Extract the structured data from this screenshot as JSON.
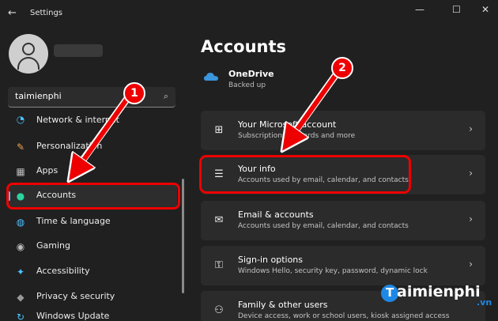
{
  "window": {
    "title": "Settings",
    "back_glyph": "←",
    "minimize_glyph": "—",
    "maximize_glyph": "☐",
    "close_glyph": "✕"
  },
  "sidebar": {
    "search_value": "taimienphi",
    "items": [
      {
        "label": "Network & internet",
        "icon": "wifi-icon"
      },
      {
        "label": "Personalization",
        "icon": "brush-icon"
      },
      {
        "label": "Apps",
        "icon": "apps-icon"
      },
      {
        "label": "Accounts",
        "icon": "person-icon",
        "active": true
      },
      {
        "label": "Time & language",
        "icon": "globe-clock-icon"
      },
      {
        "label": "Gaming",
        "icon": "gamepad-icon"
      },
      {
        "label": "Accessibility",
        "icon": "accessibility-icon"
      },
      {
        "label": "Privacy & security",
        "icon": "shield-icon"
      },
      {
        "label": "Windows Update",
        "icon": "update-icon"
      }
    ]
  },
  "main": {
    "title": "Accounts",
    "onedrive": {
      "name": "OneDrive",
      "status": "Backed up"
    },
    "cards": [
      {
        "title": "Your Microsoft account",
        "subtitle": "Subscriptions, rewards and more",
        "icon": "microsoft-logo-icon"
      },
      {
        "title": "Your info",
        "subtitle": "Accounts used by email, calendar, and contacts",
        "icon": "person-lines-icon"
      },
      {
        "title": "Email & accounts",
        "subtitle": "Accounts used by email, calendar, and contacts",
        "icon": "mail-icon"
      },
      {
        "title": "Sign-in options",
        "subtitle": "Windows Hello, security key, password, dynamic lock",
        "icon": "key-icon"
      },
      {
        "title": "Family & other users",
        "subtitle": "Device access, work or school users, kiosk assigned access",
        "icon": "family-icon"
      }
    ]
  },
  "annotations": {
    "badge1": "1",
    "badge2": "2"
  },
  "watermark": {
    "brand_t": "T",
    "brand_rest": "aimienphi",
    "suffix": ".vn"
  },
  "colors": {
    "accent": "#4cc2ff",
    "highlight": "#ee0000",
    "background": "#202020",
    "card": "#2b2b2b"
  }
}
